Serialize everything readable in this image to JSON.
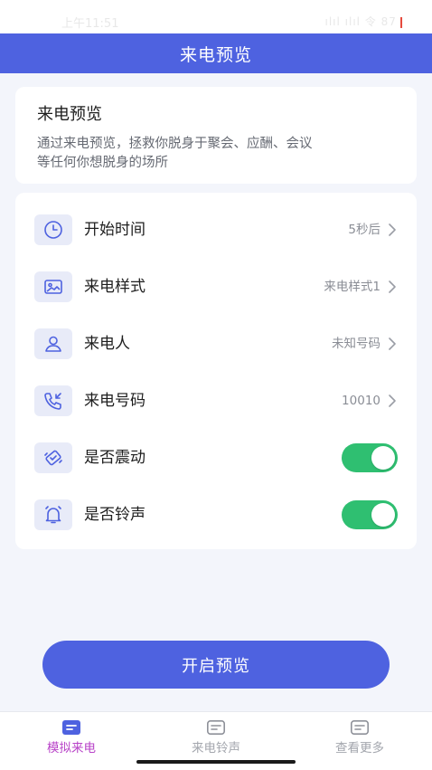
{
  "status_bar": {
    "time": "上午11:51",
    "icons": "ılıl ılıl 令",
    "battery": "87"
  },
  "header": {
    "title": "来电预览"
  },
  "intro": {
    "title": "来电预览",
    "description_line1": "通过来电预览，拯救你脱身于聚会、应酬、会议",
    "description_line2": "等任何你想脱身的场所"
  },
  "settings": [
    {
      "label": "开始时间",
      "value": "5秒后",
      "icon": "clock-icon"
    },
    {
      "label": "来电样式",
      "value": "来电样式1",
      "icon": "image-icon"
    },
    {
      "label": "来电人",
      "value": "未知号码",
      "icon": "person-icon"
    },
    {
      "label": "来电号码",
      "value": "10010",
      "icon": "phone-incoming-icon"
    },
    {
      "label": "是否震动",
      "toggle": true,
      "icon": "vibrate-icon"
    },
    {
      "label": "是否铃声",
      "toggle": true,
      "icon": "bell-icon"
    }
  ],
  "primary_button": {
    "label": "开启预览"
  },
  "tabbar": {
    "items": [
      {
        "label": "模拟来电",
        "active": true
      },
      {
        "label": "来电铃声",
        "active": false
      },
      {
        "label": "查看更多",
        "active": false
      }
    ]
  },
  "colors": {
    "accent": "#4e62e0",
    "toggle_on": "#2fbf71",
    "tab_active": "#b843c8",
    "background": "#f3f5fb"
  }
}
